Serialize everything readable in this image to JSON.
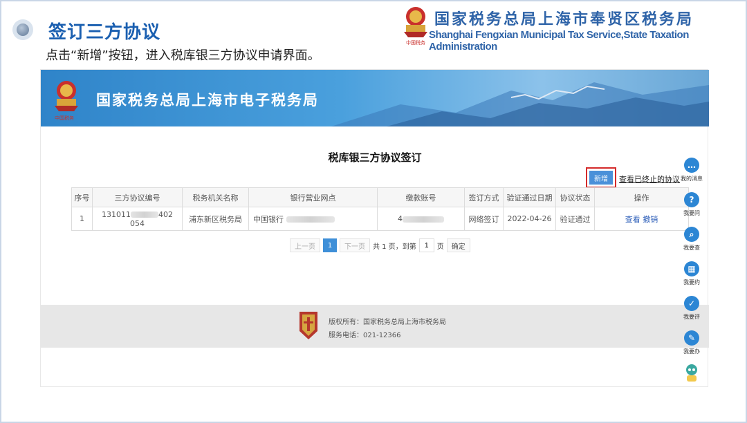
{
  "slide": {
    "title": "签订三方协议",
    "instruction": "点击“新增”按钮，进入税库银三方协议申请界面。",
    "org_cn": "国家税务总局上海市奉贤区税务局",
    "org_en": "Shanghai Fengxian Municipal Tax Service,State Taxation Administration"
  },
  "portal": {
    "banner_title": "国家税务总局上海市电子税务局",
    "page_title": "税库银三方协议签订",
    "add_button": "新增",
    "view_ended_link": "查看已终止的协议",
    "table": {
      "headers": [
        "序号",
        "三方协议编号",
        "税务机关名称",
        "银行营业网点",
        "缴款账号",
        "签订方式",
        "验证通过日期",
        "协议状态",
        "操作"
      ],
      "row": {
        "index": "1",
        "agreement_no_start": "131011",
        "agreement_no_end": "402",
        "agreement_no_line2": "054",
        "tax_office": "浦东新区税务局",
        "bank_branch": "中国银行",
        "account_start": "4",
        "sign_method": "网络签订",
        "verified_date": "2022-04-26",
        "status": "验证通过",
        "op_view": "查看",
        "op_revoke": "撤销"
      }
    },
    "pager": {
      "prev": "上一页",
      "current": "1",
      "next": "下一页",
      "total": "共 1 页，到第",
      "goto_value": "1",
      "page_unit": "页",
      "confirm": "确定"
    },
    "footer": {
      "copyright": "版权所有：国家税务总局上海市税务局",
      "phone": "服务电话：021-12366"
    },
    "sidebar": [
      {
        "label": "我的消息",
        "icon": "message-icon",
        "glyph": "…"
      },
      {
        "label": "我要问",
        "icon": "question-icon",
        "glyph": "?"
      },
      {
        "label": "我要查",
        "icon": "search-icon",
        "glyph": "⌕"
      },
      {
        "label": "我要约",
        "icon": "calendar-icon",
        "glyph": "▦"
      },
      {
        "label": "我要评",
        "icon": "rate-icon",
        "glyph": "✓"
      },
      {
        "label": "我要办",
        "icon": "edit-icon",
        "glyph": "✎"
      }
    ]
  },
  "colors": {
    "title_blue": "#1a5fb0",
    "banner_blue": "#2f84c9",
    "button_blue": "#4a90d9",
    "highlight_red": "#d42a2a"
  }
}
